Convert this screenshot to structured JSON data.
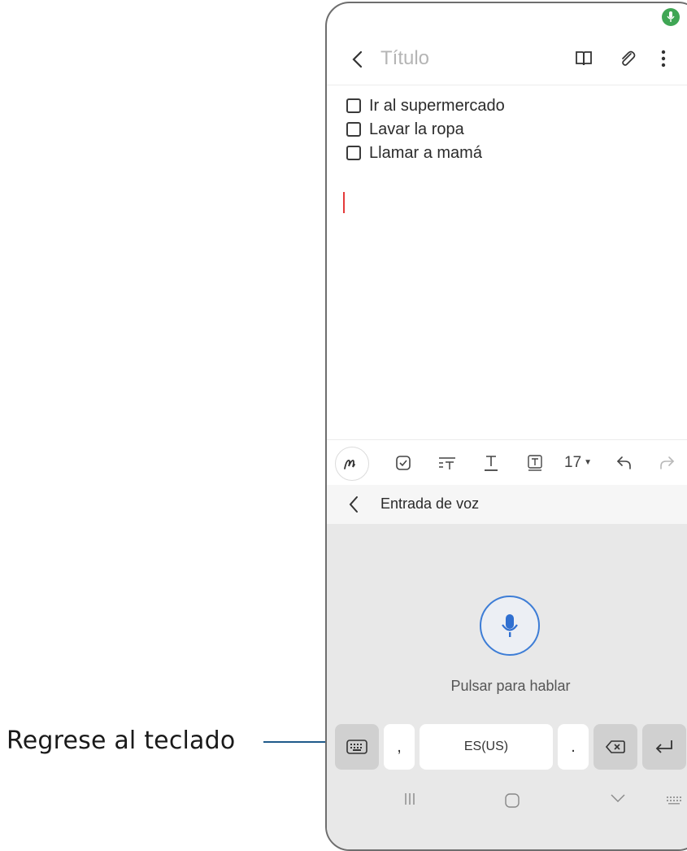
{
  "callout": {
    "label": "Regrese al teclado"
  },
  "note": {
    "title_placeholder": "Título",
    "checklist": [
      {
        "label": "Ir al supermercado",
        "checked": false
      },
      {
        "label": "Lavar la ropa",
        "checked": false
      },
      {
        "label": "Llamar a mamá",
        "checked": false
      }
    ]
  },
  "toolbar": {
    "icons": [
      "back-icon",
      "book-icon",
      "attach-icon",
      "more-icon"
    ]
  },
  "format_bar": {
    "font_size": "17",
    "icons": [
      "pen-icon",
      "checkbox-icon",
      "text-style-icon",
      "underline-icon",
      "text-box-icon",
      "undo-icon",
      "redo-icon"
    ]
  },
  "voice_input": {
    "header_title": "Entrada de voz",
    "hint": "Pulsar para hablar"
  },
  "keyboard": {
    "comma": ",",
    "space_label": "ES(US)",
    "period": "."
  },
  "colors": {
    "mic_indicator": "#3fa654",
    "mic_ring": "#3d7dd6",
    "mic_icon": "#2f6fd0",
    "cursor": "#e53a3a",
    "callout_line": "#1f5a8a"
  }
}
